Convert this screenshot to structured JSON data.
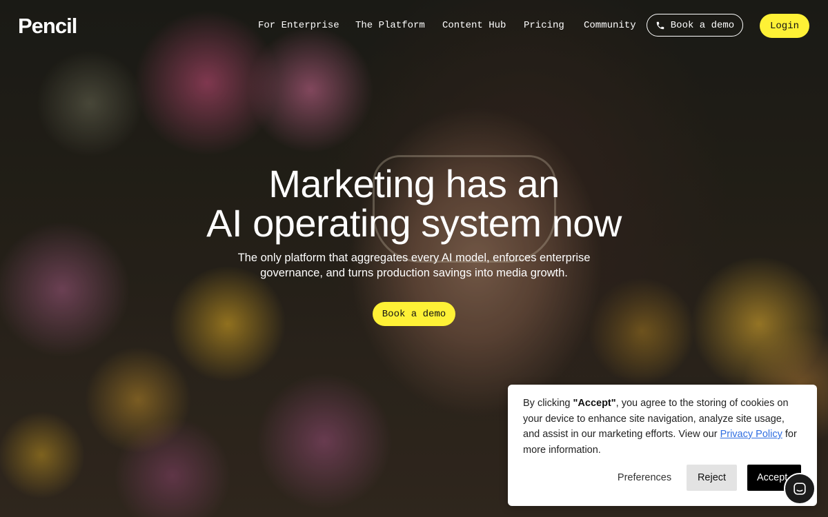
{
  "nav": {
    "logo": "Pencil",
    "links": [
      "For Enterprise",
      "The Platform",
      "Content Hub",
      "Pricing",
      "Community"
    ],
    "book_demo": "Book a demo",
    "login": "Login"
  },
  "hero": {
    "title_line1": "Marketing has an",
    "title_line2": "AI operating system now",
    "subtitle_line1": "The only platform that aggregates every AI model, enforces enterprise",
    "subtitle_line2": "governance, and turns production savings into media growth.",
    "cta": "Book a demo"
  },
  "cookie": {
    "text_before": "By clicking ",
    "accept_quoted": "\"Accept\"",
    "text_middle": ", you agree to the storing of cookies on your device to enhance site navigation, analyze site usage, and assist in our marketing efforts. View our ",
    "policy_link": "Privacy Policy",
    "text_after": " for more information.",
    "preferences": "Preferences",
    "reject": "Reject",
    "accept": "Accept"
  },
  "colors": {
    "accent_yellow": "#fef136",
    "link_blue": "#2f6de1"
  },
  "icons": {
    "phone": "phone-icon",
    "chat": "chat-bubble-icon"
  }
}
